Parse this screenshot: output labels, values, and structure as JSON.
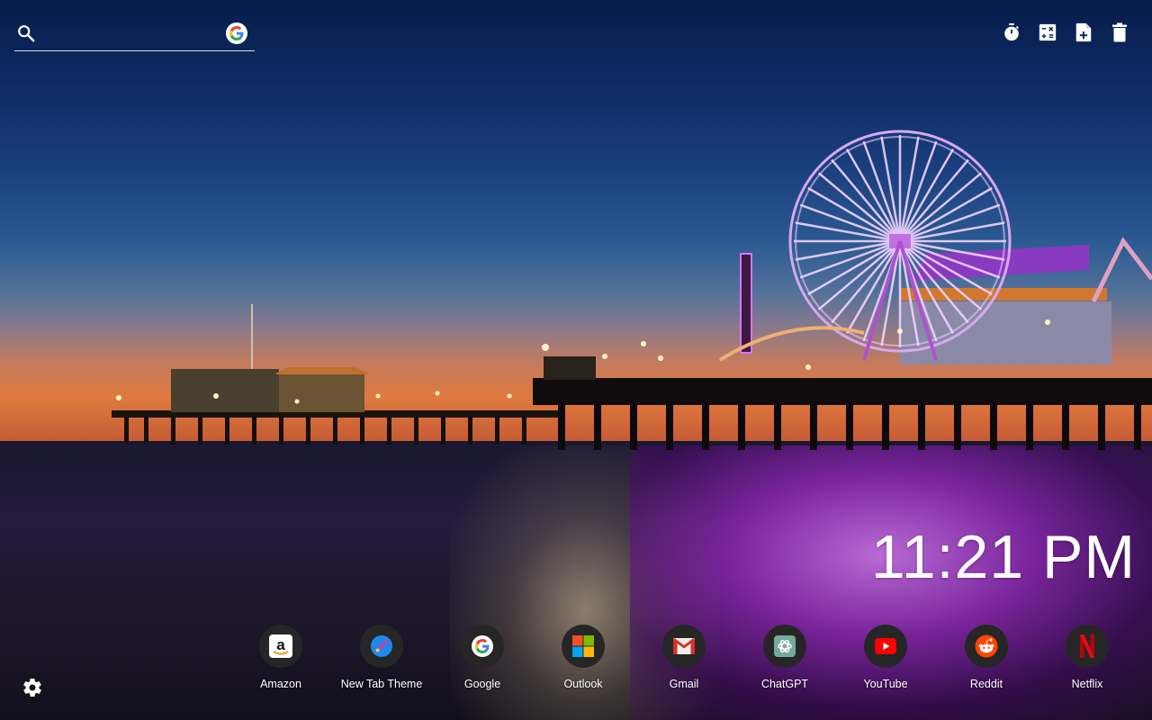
{
  "background": {
    "description": "Santa Monica pier at dusk with illuminated ferris wheel",
    "colors": {
      "sky_top": "#071d4a",
      "sky_horizon": "#e07a3e",
      "wheel": "#e8a8ff",
      "water_glow": "#b040e0"
    }
  },
  "search": {
    "placeholder": "",
    "value": "",
    "icon": "search-icon",
    "engine_icon": "google-icon"
  },
  "toolbar": {
    "buttons": [
      {
        "name": "timer",
        "icon": "stopwatch-icon"
      },
      {
        "name": "calculator",
        "icon": "calculator-icon"
      },
      {
        "name": "new-note",
        "icon": "note-add-icon"
      },
      {
        "name": "delete",
        "icon": "trash-icon"
      }
    ]
  },
  "clock": {
    "time": "11:21 PM"
  },
  "shortcuts": [
    {
      "label": "Amazon",
      "icon": "amazon-icon"
    },
    {
      "label": "New Tab Theme",
      "icon": "paintbrush-icon"
    },
    {
      "label": "Google",
      "icon": "google-icon"
    },
    {
      "label": "Outlook",
      "icon": "microsoft-icon"
    },
    {
      "label": "Gmail",
      "icon": "gmail-icon"
    },
    {
      "label": "ChatGPT",
      "icon": "chatgpt-icon"
    },
    {
      "label": "YouTube",
      "icon": "youtube-icon"
    },
    {
      "label": "Reddit",
      "icon": "reddit-icon"
    },
    {
      "label": "Netflix",
      "icon": "netflix-icon"
    }
  ],
  "settings": {
    "icon": "gear-icon"
  }
}
